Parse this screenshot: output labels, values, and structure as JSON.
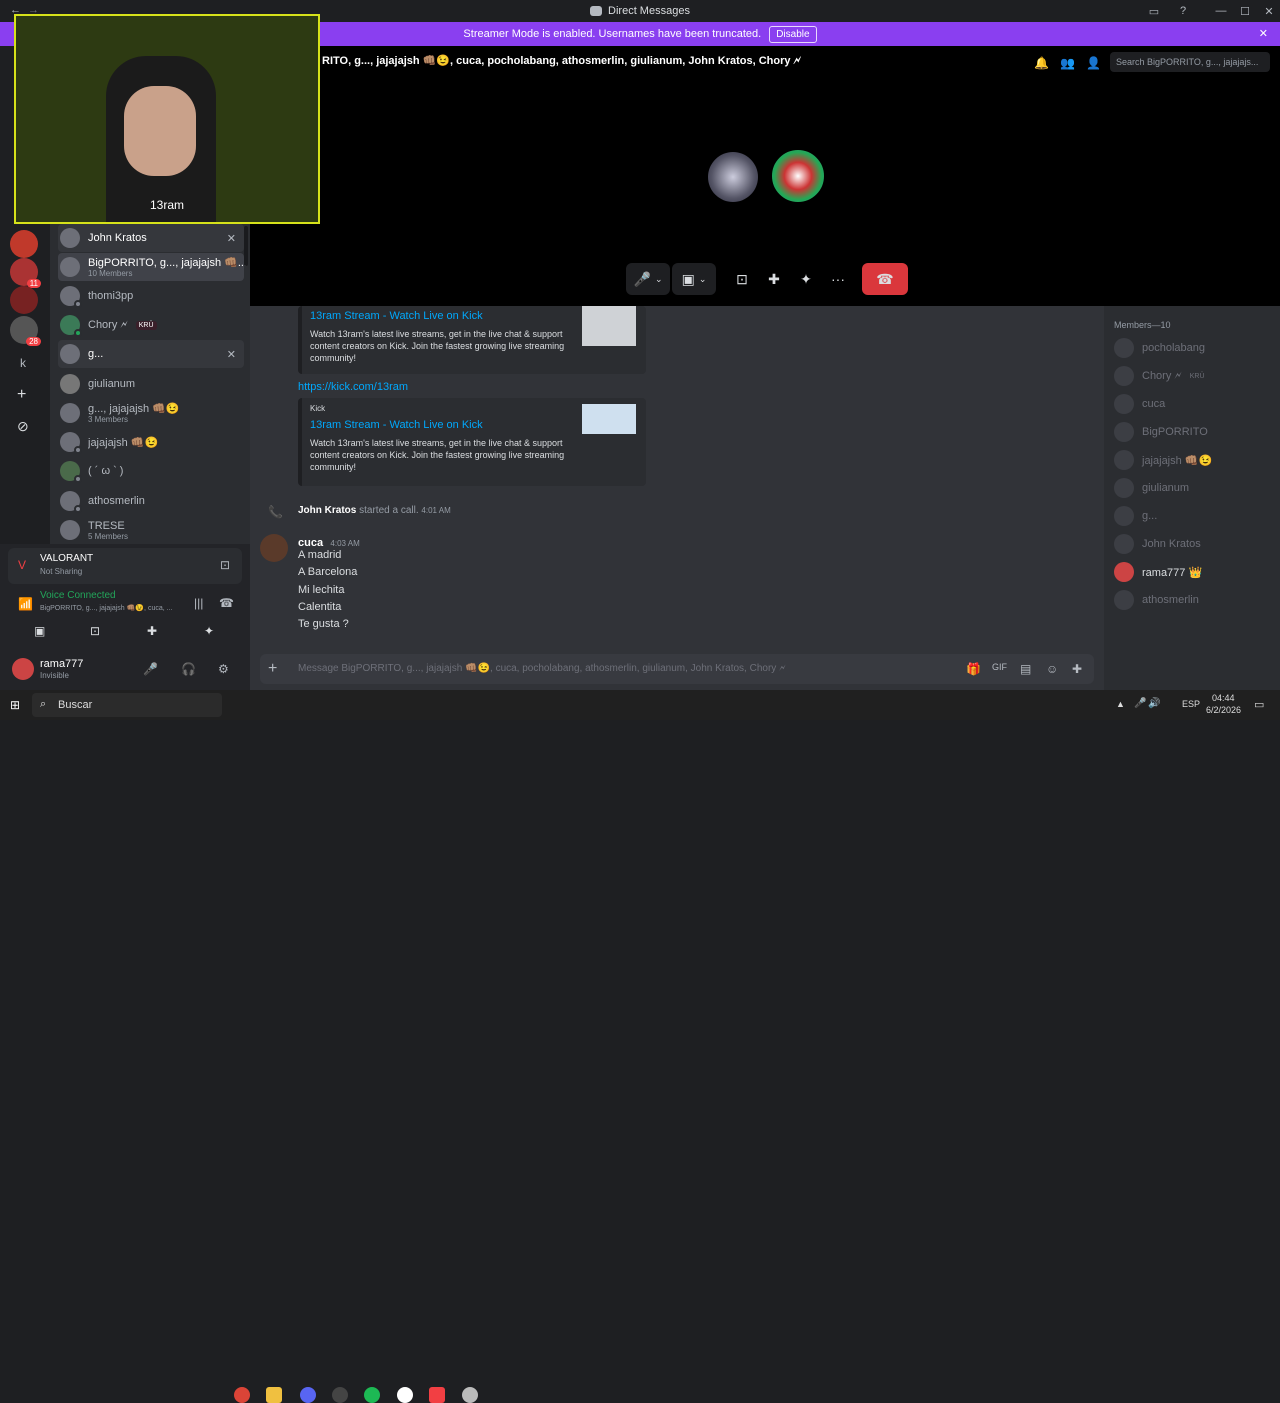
{
  "window": {
    "title": "Direct Messages",
    "back": "←",
    "forward": "→",
    "inbox_icon": "inbox-icon",
    "help_icon": "help-icon"
  },
  "banner": {
    "text": "Streamer Mode is enabled. Usernames have been truncated.",
    "button": "Disable",
    "close": "✕"
  },
  "call_header": {
    "title": "RITO, g..., jajajajsh 👊🏽😉, cuca, pocholabang, athosmerlin, giulianum, John Kratos, Chory 🗲",
    "search_placeholder": "Search BigPORRITO, g..., jajajajs..."
  },
  "cam_overlay": {
    "label": "13ram"
  },
  "dm_list": [
    {
      "name": "John Kratos",
      "sub": "",
      "close": "✕"
    },
    {
      "name": "BigPORRITO, g..., jajajajsh 👊🏽...",
      "sub": "10 Members"
    },
    {
      "name": "thomi3pp",
      "sub": ""
    },
    {
      "name": "Chory 🗲",
      "sub": "",
      "badge": "KRÜ"
    },
    {
      "name": "g...",
      "sub": "",
      "close": "✕"
    },
    {
      "name": "giulianum",
      "sub": ""
    },
    {
      "name": "g..., jajajajsh 👊🏽😉",
      "sub": "3 Members"
    },
    {
      "name": "jajajajsh 👊🏽😉",
      "sub": ""
    },
    {
      "name": "( ´ ω ` )",
      "sub": ""
    },
    {
      "name": "athosmerlin",
      "sub": ""
    },
    {
      "name": "TRESE",
      "sub": "5 Members"
    }
  ],
  "rail": {
    "badge_1": "11",
    "badge_2": "28",
    "k_label": "k",
    "add": "+",
    "explore": "⊘"
  },
  "activity": {
    "title": "VALORANT",
    "status": "Not Sharing"
  },
  "voice": {
    "status": "Voice Connected",
    "channel": "BigPORRITO, g..., jajajajsh 👊🏽😉, cuca, ..."
  },
  "user": {
    "name": "rama777",
    "status": "Invisible"
  },
  "messages": {
    "embed1": {
      "title": "13ram Stream - Watch Live on Kick",
      "desc": "Watch 13ram's latest live streams, get in the live chat & support content creators on Kick. Join the fastest growing live streaming community!"
    },
    "link": "https://kick.com/13ram",
    "embed2": {
      "provider": "Kick",
      "title": "13ram Stream - Watch Live on Kick",
      "desc": "Watch 13ram's latest live streams, get in the live chat & support content creators on Kick. Join the fastest growing live streaming community!"
    },
    "call": {
      "user": "John Kratos",
      "text": "started a call.",
      "time": "4:01 AM"
    },
    "cuca": {
      "user": "cuca",
      "time": "4:03 AM",
      "lines": [
        "A madrid",
        "A Barcelona",
        "Mi lechita",
        "Calentita",
        "Te gusta ?"
      ]
    }
  },
  "composer": {
    "placeholder": "Message BigPORRITO, g..., jajajajsh 👊🏽😉, cuca, pocholabang, athosmerlin, giulianum, John Kratos, Chory 🗲",
    "add": "+"
  },
  "members": {
    "header": "Members—10",
    "list": [
      "pocholabang",
      "Chory 🗲",
      "cuca",
      "BigPORRITO",
      "jajajajsh 👊🏽😉",
      "giulianum",
      "g...",
      "John Kratos",
      "rama777 👑",
      "athosmerlin"
    ],
    "chory_badge": "KRÜ"
  },
  "taskbar": {
    "search": "Buscar",
    "lang": "ESP",
    "time": "04:44",
    "date": "6/2/2026"
  }
}
